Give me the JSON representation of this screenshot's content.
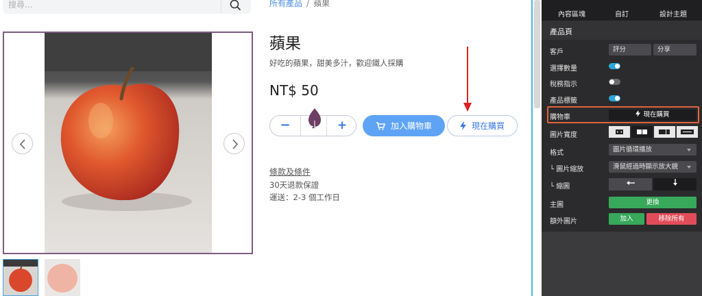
{
  "search": {
    "placeholder": "搜尋..."
  },
  "breadcrumb": {
    "parent": "所有產品",
    "separator": "/",
    "current": "蘋果"
  },
  "product": {
    "title": "蘋果",
    "subtitle": "好吃的蘋果，甜美多汁，歡迎鐵人採購",
    "price": "NT$ 50",
    "quantity": "1",
    "add_to_cart_label": "加入購物車",
    "buy_now_label": "現在購買",
    "terms_label": "條款及條件",
    "policy_line1": "30天退款保證",
    "policy_line2": "運送：2-3 個工作日"
  },
  "panel": {
    "tabs": [
      "內容區塊",
      "自訂",
      "設計主題"
    ],
    "section_title": "產品頁",
    "customer_label": "客戶",
    "customer_rating": "評分",
    "customer_share": "分享",
    "select_qty_label": "選擇數量",
    "tax_label": "稅務指示",
    "product_tag_label": "產品標籤",
    "cart_label": "購物車",
    "cart_option": "現在購買",
    "image_width_label": "圖片寬度",
    "format_label": "格式",
    "format_value": "圖片循環播放",
    "zoom_label": "└ 圖片縮放",
    "zoom_value": "滑鼠經過時顯示放大鏡",
    "thumbnail_label": "└ 縮圖",
    "main_image_label": "主圖",
    "main_image_button": "更換",
    "extra_images_label": "額外圖片",
    "add_button": "加入",
    "remove_all_button": "移除所有"
  },
  "toggles": {
    "select_qty": true,
    "tax": false,
    "product_tag": true
  },
  "colors": {
    "accent_blue": "#5ea3f5",
    "link_blue": "#3a78e0",
    "panel_bg": "#2b2b2d",
    "highlight_orange": "#e0643a",
    "toggle_on": "#2aa7d6",
    "green": "#38a85a",
    "red": "#e24c5a",
    "arrow_red": "#e02020"
  }
}
